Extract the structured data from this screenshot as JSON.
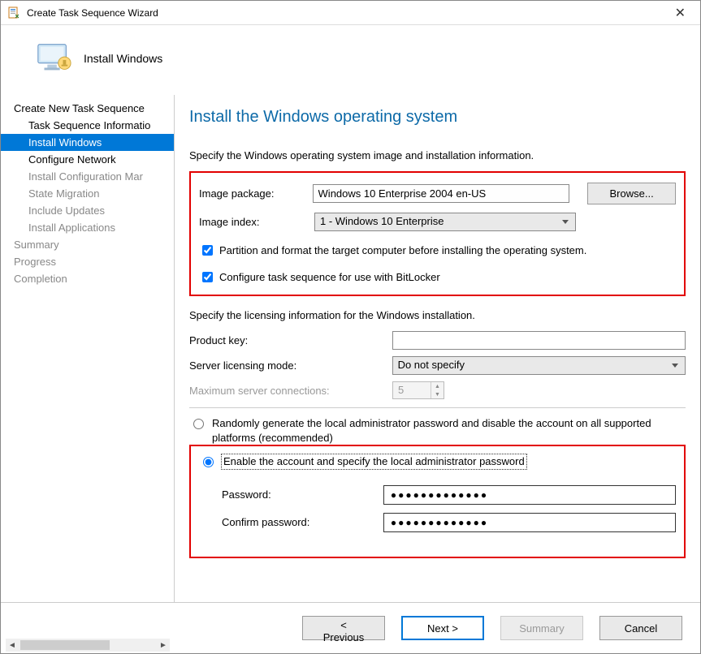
{
  "window": {
    "title": "Create Task Sequence Wizard"
  },
  "header": {
    "title": "Install Windows"
  },
  "sidebar": {
    "items": [
      {
        "label": "Create New Task Sequence",
        "level": 1,
        "state": "heading"
      },
      {
        "label": "Task Sequence Informatio",
        "level": 2,
        "state": "done"
      },
      {
        "label": "Install Windows",
        "level": 2,
        "state": "active"
      },
      {
        "label": "Configure Network",
        "level": 2,
        "state": "done"
      },
      {
        "label": "Install Configuration Mar",
        "level": 2,
        "state": "pending"
      },
      {
        "label": "State Migration",
        "level": 2,
        "state": "pending"
      },
      {
        "label": "Include Updates",
        "level": 2,
        "state": "pending"
      },
      {
        "label": "Install Applications",
        "level": 2,
        "state": "pending"
      },
      {
        "label": "Summary",
        "level": 1,
        "state": "pending"
      },
      {
        "label": "Progress",
        "level": 1,
        "state": "pending"
      },
      {
        "label": "Completion",
        "level": 1,
        "state": "pending"
      }
    ]
  },
  "page": {
    "title": "Install the Windows operating system",
    "specify_image_text": "Specify the Windows operating system image and installation information.",
    "image_package_label": "Image package:",
    "image_package_value": "Windows 10 Enterprise 2004 en-US",
    "browse_label": "Browse...",
    "image_index_label": "Image index:",
    "image_index_value": "1 - Windows 10 Enterprise",
    "partition_checkbox": "Partition and format the target computer before installing the operating system.",
    "bitlocker_checkbox": "Configure task sequence for use with BitLocker",
    "licensing_text": "Specify the licensing information for the Windows installation.",
    "product_key_label": "Product key:",
    "product_key_value": "",
    "server_mode_label": "Server licensing mode:",
    "server_mode_value": "Do not specify",
    "max_conn_label": "Maximum server connections:",
    "max_conn_value": "5",
    "radio_random": "Randomly generate the local administrator password and disable the account on all supported platforms (recommended)",
    "radio_enable": "Enable the account and specify the local administrator password",
    "password_label": "Password:",
    "confirm_label": "Confirm password:",
    "password_mask": "●●●●●●●●●●●●●",
    "confirm_mask": "●●●●●●●●●●●●●"
  },
  "footer": {
    "previous": "< Previous",
    "next": "Next >",
    "summary": "Summary",
    "cancel": "Cancel"
  }
}
